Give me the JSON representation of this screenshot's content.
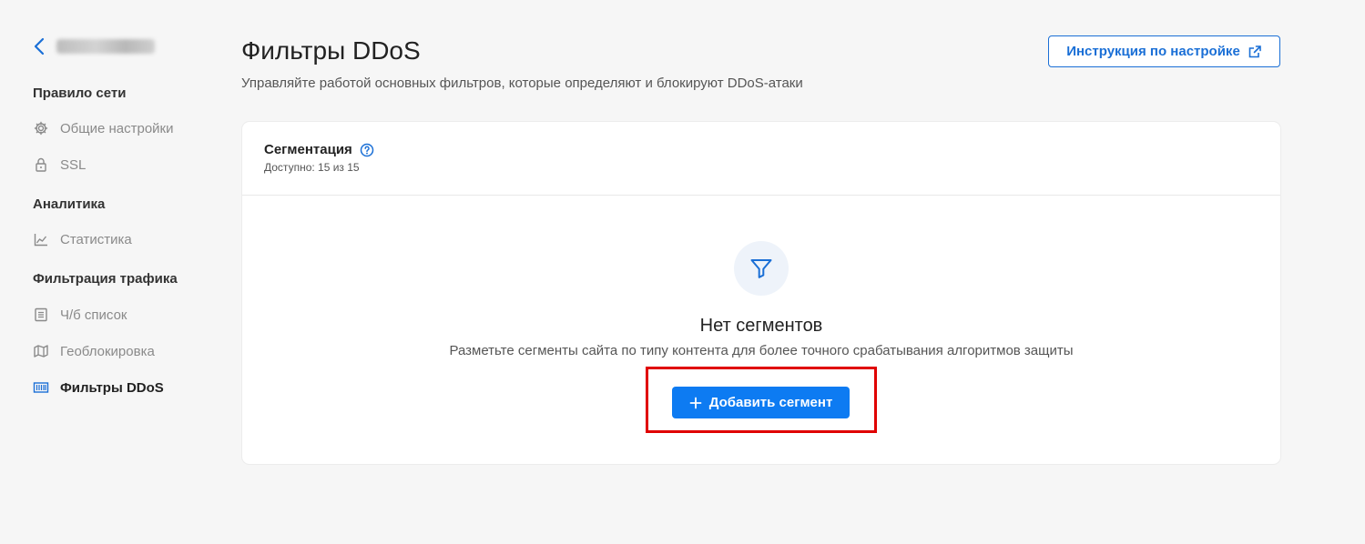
{
  "sidebar": {
    "sections": [
      {
        "title": "Правило сети",
        "items": [
          {
            "label": "Общие настройки",
            "icon": "gear-icon"
          },
          {
            "label": "SSL",
            "icon": "lock-icon"
          }
        ]
      },
      {
        "title": "Аналитика",
        "items": [
          {
            "label": "Статистика",
            "icon": "chart-icon"
          }
        ]
      },
      {
        "title": "Фильтрация трафика",
        "items": [
          {
            "label": "Ч/б список",
            "icon": "list-icon"
          },
          {
            "label": "Геоблокировка",
            "icon": "map-icon"
          },
          {
            "label": "Фильтры DDoS",
            "icon": "ddos-filter-icon",
            "active": true
          }
        ]
      }
    ]
  },
  "header": {
    "title": "Фильтры DDoS",
    "subtitle": "Управляйте работой основных фильтров, которые определяют и блокируют DDoS-атаки",
    "guide_button": "Инструкция по настройке"
  },
  "segmentation": {
    "title": "Сегментация",
    "available": "Доступно: 15 из 15",
    "empty_title": "Нет сегментов",
    "empty_description": "Разметьте сегменты сайта по типу контента для более точного срабатывания алгоритмов защиты",
    "add_button": "Добавить сегмент"
  },
  "colors": {
    "accent": "#0d7bf2",
    "link": "#1a6fd6",
    "highlight": "#e00000"
  }
}
